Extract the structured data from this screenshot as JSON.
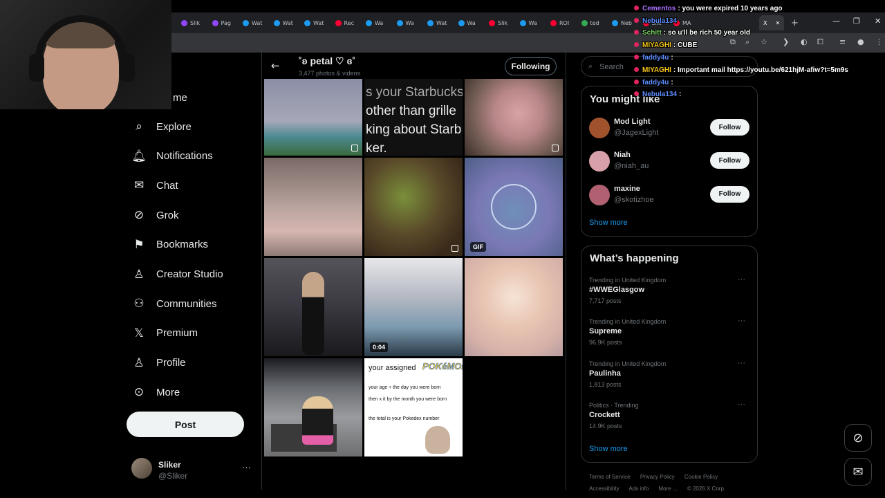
{
  "browser": {
    "tabs": [
      {
        "label": "Slik",
        "color": "#9146ff"
      },
      {
        "label": "Pag",
        "color": "#9146ff"
      },
      {
        "label": "Wat",
        "color": "#1d9bf0"
      },
      {
        "label": "Wat",
        "color": "#1d9bf0"
      },
      {
        "label": "Wat",
        "color": "#1d9bf0"
      },
      {
        "label": "Rec",
        "color": "#ff0033"
      },
      {
        "label": "Wa",
        "color": "#1d9bf0"
      },
      {
        "label": "Wa",
        "color": "#1d9bf0"
      },
      {
        "label": "Wat",
        "color": "#1d9bf0"
      },
      {
        "label": "Wa",
        "color": "#1d9bf0"
      },
      {
        "label": "Slik",
        "color": "#ff0033"
      },
      {
        "label": "Wa",
        "color": "#1d9bf0"
      },
      {
        "label": "ROI",
        "color": "#ff0033"
      },
      {
        "label": "ted",
        "color": "#34a853"
      },
      {
        "label": "Neb",
        "color": "#1d9bf0"
      },
      {
        "label": "Slik",
        "color": "#ff0033"
      },
      {
        "label": "MA",
        "color": "#ff0033"
      }
    ],
    "active_tab_icon": "X",
    "new_tab": "+",
    "win_minimize": "—",
    "win_restore": "❐",
    "win_close": "✕"
  },
  "nav": {
    "home_partial": "me",
    "items": [
      {
        "label": "Explore",
        "icon": "search-icon",
        "glyph": "⌕"
      },
      {
        "label": "Notifications",
        "icon": "bell-icon",
        "glyph": "🔔︎"
      },
      {
        "label": "Chat",
        "icon": "mail-icon",
        "glyph": "✉"
      },
      {
        "label": "Grok",
        "icon": "grok-icon",
        "glyph": "⊘"
      },
      {
        "label": "Bookmarks",
        "icon": "bookmark-icon",
        "glyph": "⚑"
      },
      {
        "label": "Creator Studio",
        "icon": "creator-studio-icon",
        "glyph": "♙"
      },
      {
        "label": "Communities",
        "icon": "communities-icon",
        "glyph": "⚇"
      },
      {
        "label": "Premium",
        "icon": "x-logo-icon",
        "glyph": "𝕏"
      },
      {
        "label": "Profile",
        "icon": "person-icon",
        "glyph": "♙"
      },
      {
        "label": "More",
        "icon": "more-circle-icon",
        "glyph": "⊙"
      }
    ],
    "post_label": "Post"
  },
  "account": {
    "name": "Sliker",
    "handle": "@Sliker",
    "more": "···"
  },
  "profile_header": {
    "name": "˚ʚ petal ♡ ɞ˚",
    "count": "3,477 photos & videos",
    "following_label": "Following"
  },
  "media": {
    "tile2_text": [
      "s your Starbucks",
      "other than grille",
      "king about Starb",
      "ker."
    ],
    "tile6_badge": "GIF",
    "tile8_badge": "0:04",
    "tile11": {
      "heading": "your assigned",
      "brand": "POKéMON",
      "line1": "your age + the day you were born",
      "line2": "then x it by the month you were born",
      "line3": "the total is your Pokedex number"
    }
  },
  "search": {
    "placeholder": "Search"
  },
  "you_might_like": {
    "title": "You might like",
    "users": [
      {
        "name": "Mod Light",
        "handle": "@JagexLight",
        "button": "Follow",
        "avatar": "#a0522d"
      },
      {
        "name": "Niah",
        "handle": "@niah_au",
        "button": "Follow",
        "avatar": "#d8a0a8"
      },
      {
        "name": "maxine",
        "handle": "@skotizhoe",
        "button": "Follow",
        "avatar": "#b06070"
      }
    ],
    "show_more": "Show more"
  },
  "whats_happening": {
    "title": "What’s happening",
    "trends": [
      {
        "context": "Trending in United Kingdom",
        "topic": "#WWEGlasgow",
        "posts": "7,717 posts"
      },
      {
        "context": "Trending in United Kingdom",
        "topic": "Supreme",
        "posts": "96.9K posts"
      },
      {
        "context": "Trending in United Kingdom",
        "topic": "Paulinha",
        "posts": "1,813 posts"
      },
      {
        "context": "Politics · Trending",
        "topic": "Crockett",
        "posts": "14.9K posts"
      }
    ],
    "show_more": "Show more"
  },
  "footer": {
    "terms": "Terms of Service",
    "privacy": "Privacy Policy",
    "cookie": "Cookie Policy",
    "accessibility": "Accessibility",
    "ads": "Ads info",
    "more": "More ...",
    "copyright": "© 2026 X Corp."
  },
  "chat": [
    {
      "user": "Cementos",
      "color": "#a970ff",
      "message": ": you were expired 10 years ago"
    },
    {
      "user": "Nebula134",
      "color": "#5b8cff",
      "message": ""
    },
    {
      "user": "Schitt",
      "color": "#7fd46b",
      "message": ": so u'll be rich 50 year old"
    },
    {
      "user": "MIYAGHI",
      "color": "#f5c518",
      "message": ": CUBE"
    },
    {
      "user": "faddy4u",
      "color": "#5b8cff",
      "message": ":"
    },
    {
      "user": "MIYAGHI",
      "color": "#f5c518",
      "message": ": Important mail https://youtu.be/621hjM-afiw?t=5m9s"
    },
    {
      "user": "faddy4u",
      "color": "#5b8cff",
      "message": ":"
    },
    {
      "user": "Nebula134",
      "color": "#5b8cff",
      "message": ":"
    }
  ]
}
